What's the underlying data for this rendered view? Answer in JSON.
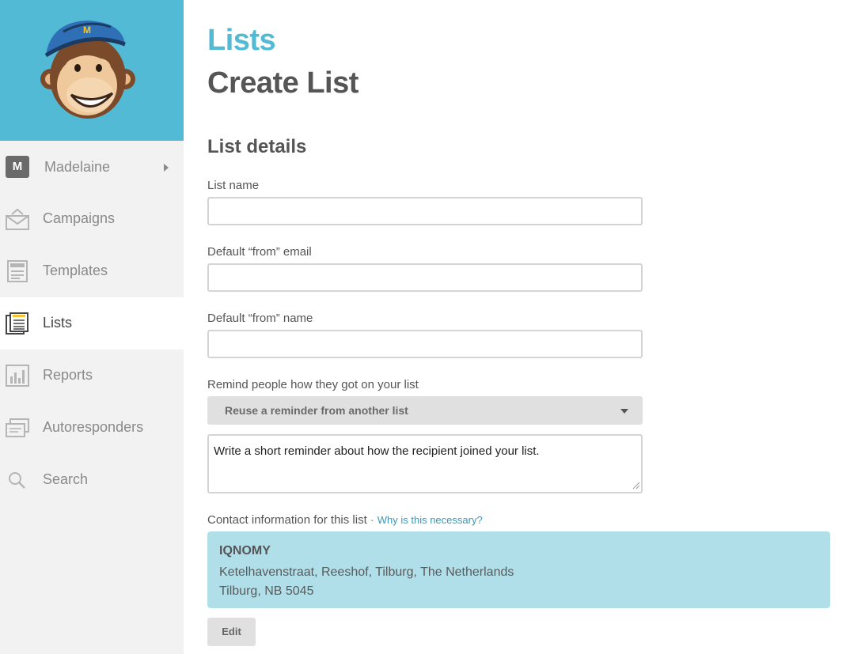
{
  "sidebar": {
    "logo": "freddie-monkey-logo",
    "user": {
      "initial": "M",
      "name": "Madelaine"
    },
    "items": [
      {
        "label": "Campaigns",
        "icon": "envelope-icon"
      },
      {
        "label": "Templates",
        "icon": "template-icon"
      },
      {
        "label": "Lists",
        "icon": "list-icon",
        "active": true
      },
      {
        "label": "Reports",
        "icon": "bar-chart-icon"
      },
      {
        "label": "Autoresponders",
        "icon": "autoresponder-icon"
      },
      {
        "label": "Search",
        "icon": "search-icon"
      }
    ]
  },
  "header": {
    "section": "Lists",
    "title": "Create List"
  },
  "form": {
    "heading": "List details",
    "list_name": {
      "label": "List name",
      "value": ""
    },
    "from_email": {
      "label": "Default “from” email",
      "value": ""
    },
    "from_name": {
      "label": "Default “from” name",
      "value": ""
    },
    "reminder": {
      "label": "Remind people how they got on your list",
      "select_value": "Reuse a reminder from another list",
      "textarea_text": "Write a short reminder about how the recipient joined your list."
    },
    "contact": {
      "label": "Contact information for this list",
      "separator": "·",
      "why_link": "Why is this necessary?",
      "org": "IQNOMY",
      "address_line1": "Ketelhavenstraat, Reeshof, Tilburg, The Netherlands",
      "address_line2": "Tilburg, NB 5045",
      "edit_label": "Edit"
    }
  },
  "colors": {
    "accent": "#52bad5",
    "sidebar_bg": "#f2f2f2",
    "contact_bg": "#b0dfea",
    "link": "#3b97b5"
  }
}
